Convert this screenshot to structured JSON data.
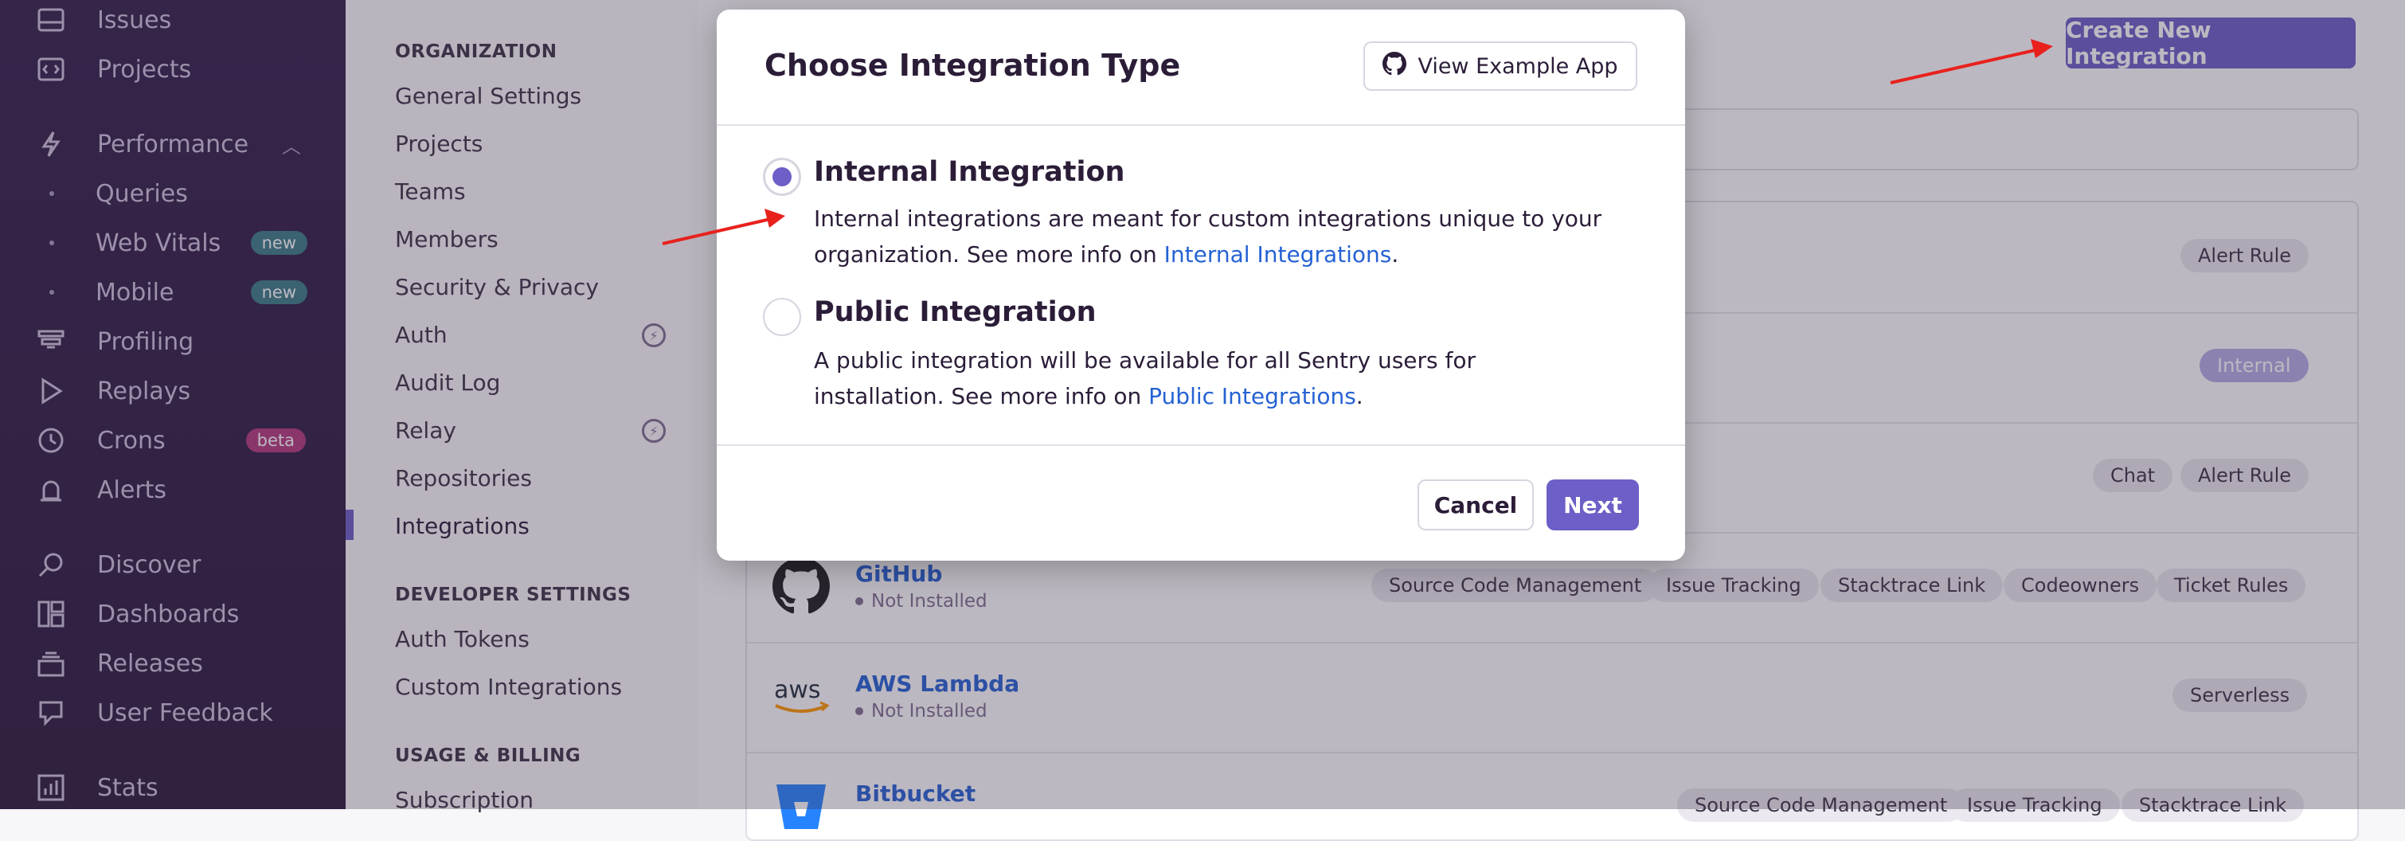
{
  "sidebar": {
    "items": [
      {
        "label": "Issues",
        "icon": "issues-icon"
      },
      {
        "label": "Projects",
        "icon": "projects-icon"
      },
      {
        "label": "Performance",
        "icon": "performance-icon"
      },
      {
        "label": "Queries"
      },
      {
        "label": "Web Vitals",
        "badge": "new"
      },
      {
        "label": "Mobile",
        "badge": "new"
      },
      {
        "label": "Profiling",
        "icon": "profiling-icon"
      },
      {
        "label": "Replays",
        "icon": "replays-icon"
      },
      {
        "label": "Crons",
        "icon": "crons-icon",
        "badge": "beta"
      },
      {
        "label": "Alerts",
        "icon": "alerts-icon"
      },
      {
        "label": "Discover",
        "icon": "discover-icon"
      },
      {
        "label": "Dashboards",
        "icon": "dashboards-icon"
      },
      {
        "label": "Releases",
        "icon": "releases-icon"
      },
      {
        "label": "User Feedback",
        "icon": "user-feedback-icon"
      },
      {
        "label": "Stats",
        "icon": "stats-icon"
      }
    ]
  },
  "settings": {
    "org_heading": "ORGANIZATION",
    "org_links": [
      "General Settings",
      "Projects",
      "Teams",
      "Members",
      "Security & Privacy",
      "Auth",
      "Audit Log",
      "Relay",
      "Repositories",
      "Integrations"
    ],
    "dev_heading": "DEVELOPER SETTINGS",
    "dev_links": [
      "Auth Tokens",
      "Custom Integrations"
    ],
    "usage_heading": "USAGE & BILLING",
    "usage_links": [
      "Subscription"
    ]
  },
  "main": {
    "create_label": "Create New Integration",
    "rows": [
      {
        "name": "",
        "status": "",
        "tags": [
          "Alert Rule"
        ]
      },
      {
        "name": "",
        "status": "",
        "tags": [
          "Internal"
        ]
      },
      {
        "name": "",
        "status": "",
        "tags": [
          "Chat",
          "Alert Rule"
        ]
      },
      {
        "name": "GitHub",
        "status": "Not Installed",
        "tags": [
          "Source Code Management",
          "Issue Tracking",
          "Stacktrace Link",
          "Codeowners",
          "Ticket Rules"
        ]
      },
      {
        "name": "AWS Lambda",
        "status": "Not Installed",
        "tags": [
          "Serverless"
        ]
      },
      {
        "name": "Bitbucket",
        "status": "",
        "tags": [
          "Source Code Management",
          "Issue Tracking",
          "Stacktrace Link"
        ]
      }
    ]
  },
  "modal": {
    "title": "Choose Integration Type",
    "example_label": "View Example App",
    "internal": {
      "title": "Internal Integration",
      "desc_before": "Internal integrations are meant for custom integrations unique to your organization. See more info on ",
      "link": "Internal Integrations",
      "desc_after": ".",
      "selected": true
    },
    "public": {
      "title": "Public Integration",
      "desc_before": "A public integration will be available for all Sentry users for installation. See more info on ",
      "link": "Public Integrations",
      "desc_after": ".",
      "selected": false
    },
    "cancel_label": "Cancel",
    "next_label": "Next"
  },
  "colors": {
    "accent": "#6c5fc7",
    "link": "#2562d4",
    "sidebar": "#2f1d42",
    "annotation_arrow": "#e8211d"
  }
}
